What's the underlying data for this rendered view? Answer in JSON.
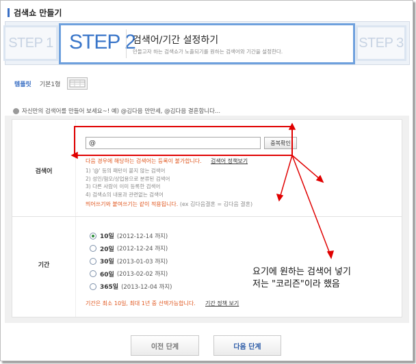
{
  "page": {
    "title": "검색쇼 만들기"
  },
  "steps": {
    "step1": "STEP 1",
    "step2": "STEP 2",
    "step3": "STEP 3",
    "heading": "검색어/기간 설정하기",
    "subtext": "만들고자 하는 검색쇼가 노출되기를 원하는 검색어와 기간을 설정한다."
  },
  "template": {
    "label": "템플릿",
    "value": "기본1형"
  },
  "hint": {
    "text": "자신만의 검색어를 만들어 보세요~!  예) @김다음 만만세, @김다음 결혼합니다..."
  },
  "search": {
    "label": "검색어",
    "input_value": "@",
    "dup_check": "중복확인",
    "warning": "다음 경우에 해당하는 검색어는 등록이 불가합니다.",
    "policy_link": "검색어 정책보기",
    "rules": [
      "1) '@' 등의 패턴이 붙지 않는 검색어",
      "2) 성인/혐오/상업용으로 분류된 검색어",
      "3) 다른 사람이 이미 등록한 검색어",
      "4) 검색쇼의 내용과 관련없는 검색어"
    ],
    "spacing_note_a": "띄어쓰기와 붙여쓰기는 같이 적용됩니다.",
    "spacing_note_b": " (ex 김다음결혼 = 김다음 결혼)"
  },
  "period": {
    "label": "기간",
    "selected_index": 0,
    "options": [
      {
        "days": "10일",
        "until": "(2012-12-14 까지)"
      },
      {
        "days": "20일",
        "until": "(2012-12-24 까지)"
      },
      {
        "days": "30일",
        "until": "(2013-01-03 까지)"
      },
      {
        "days": "60일",
        "until": "(2013-02-02 까지)"
      },
      {
        "days": "365일",
        "until": "(2013-12-04 까지)"
      }
    ],
    "note": "기간은 최소 10일, 최대 1년 중 선택가능합니다.",
    "policy_link": "기간 정책 보기"
  },
  "annotation": {
    "text": "요기에 원하는 검색어 넣기\n저는 \"코리즌\"이라 했음"
  },
  "buttons": {
    "prev": "이전 단계",
    "next": "다음 단계"
  },
  "colors": {
    "accent": "#3a76c9",
    "warning": "#e0571f",
    "annotation": "#e00000",
    "radio_on": "#2d8f3a"
  }
}
